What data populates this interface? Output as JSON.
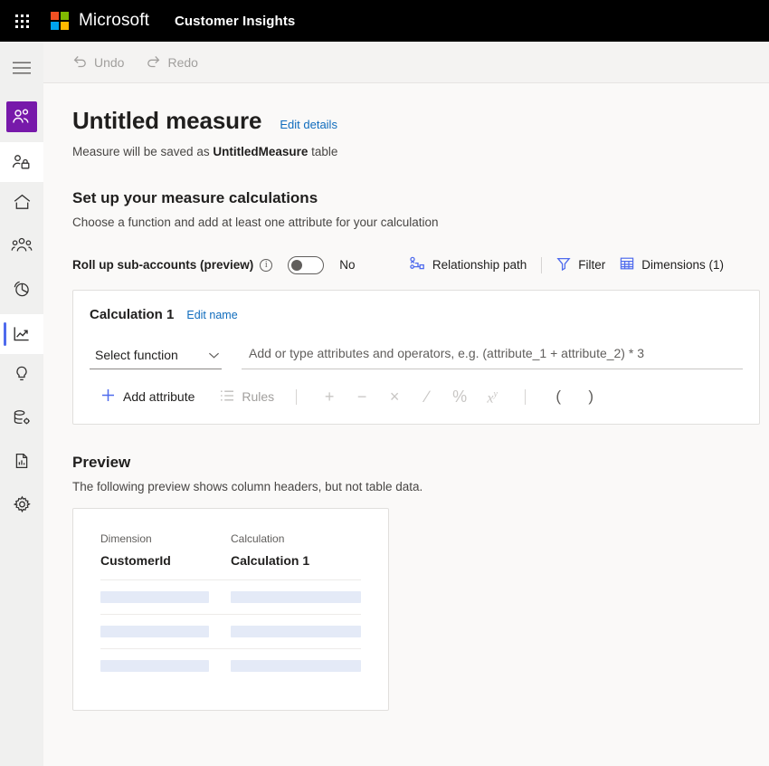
{
  "topbar": {
    "waffle_icon": "app-launcher-icon",
    "brand": "Microsoft",
    "app_name": "Customer Insights"
  },
  "command_bar": {
    "undo": {
      "label": "Undo",
      "icon": "undo-icon",
      "disabled": true
    },
    "redo": {
      "label": "Redo",
      "icon": "redo-icon",
      "disabled": true
    }
  },
  "rail": {
    "hamburger_icon": "hamburger-menu-icon",
    "items": [
      {
        "name": "audience-insights",
        "icon": "people-icon",
        "active_tile": true
      },
      {
        "name": "customer-profile",
        "icon": "person-lock-icon",
        "active_tile": false
      },
      {
        "name": "home",
        "icon": "home-icon",
        "active_tile": false
      },
      {
        "name": "customers",
        "icon": "people-group-icon",
        "active_tile": false
      },
      {
        "name": "segments",
        "icon": "pie-chart-icon",
        "active_tile": false
      },
      {
        "name": "measures",
        "icon": "line-chart-icon",
        "active_tile": false,
        "selected": true
      },
      {
        "name": "intelligence",
        "icon": "lightbulb-icon",
        "active_tile": false
      },
      {
        "name": "data",
        "icon": "database-gear-icon",
        "active_tile": false
      },
      {
        "name": "reports",
        "icon": "document-chart-icon",
        "active_tile": false
      },
      {
        "name": "settings",
        "icon": "gear-icon",
        "active_tile": false
      }
    ]
  },
  "page": {
    "title": "Untitled measure",
    "edit_details_link": "Edit details",
    "subtitle_prefix": "Measure will be saved as ",
    "subtitle_bold": "UntitledMeasure",
    "subtitle_suffix": " table",
    "section_heading": "Set up your measure calculations",
    "section_subheading": "Choose a function and add at least one attribute for your calculation"
  },
  "options": {
    "rollup_label": "Roll up sub-accounts (preview)",
    "info_icon": "info-icon",
    "toggle_state": "No",
    "toggle_on": false,
    "relationship_path": {
      "label": "Relationship path",
      "icon": "relationship-path-icon"
    },
    "filter": {
      "label": "Filter",
      "icon": "filter-icon"
    },
    "dimensions": {
      "label": "Dimensions (1)",
      "icon": "table-grid-icon"
    }
  },
  "calculation": {
    "title": "Calculation 1",
    "edit_name_link": "Edit name",
    "function_select": "Select function",
    "chevron_icon": "chevron-down-icon",
    "formula_placeholder": "Add or type attributes and operators, e.g. (attribute_1 + attribute_2) * 3",
    "add_attribute": {
      "label": "Add attribute",
      "icon": "plus-icon"
    },
    "rules": {
      "label": "Rules",
      "icon": "list-rules-icon",
      "disabled": true
    },
    "operators": [
      {
        "name": "operator-plus",
        "glyph": "+"
      },
      {
        "name": "operator-minus",
        "glyph": "−"
      },
      {
        "name": "operator-multiply",
        "glyph": "×"
      },
      {
        "name": "operator-divide",
        "glyph": "∕"
      },
      {
        "name": "operator-percent",
        "glyph": "%"
      }
    ],
    "power_operator": {
      "name": "operator-power",
      "base": "x",
      "exponent": "y"
    },
    "parens": [
      {
        "name": "operator-open-paren",
        "glyph": "("
      },
      {
        "name": "operator-close-paren",
        "glyph": ")"
      }
    ]
  },
  "preview": {
    "heading": "Preview",
    "subheading": "The following preview shows column headers, but not table data.",
    "columns": [
      {
        "label": "Dimension",
        "header": "CustomerId"
      },
      {
        "label": "Calculation",
        "header": "Calculation 1"
      }
    ],
    "placeholder_row_count": 3
  },
  "colors": {
    "topbar_bg": "#000000",
    "rail_bg": "#f0f0ef",
    "canvas_bg": "#faf9f8",
    "accent_purple": "#7719aa",
    "accent_blue": "#4f6bed",
    "link_blue": "#0f6cbd",
    "icon_blue": "#4f6bed",
    "skeleton": "#e4eaf7"
  }
}
